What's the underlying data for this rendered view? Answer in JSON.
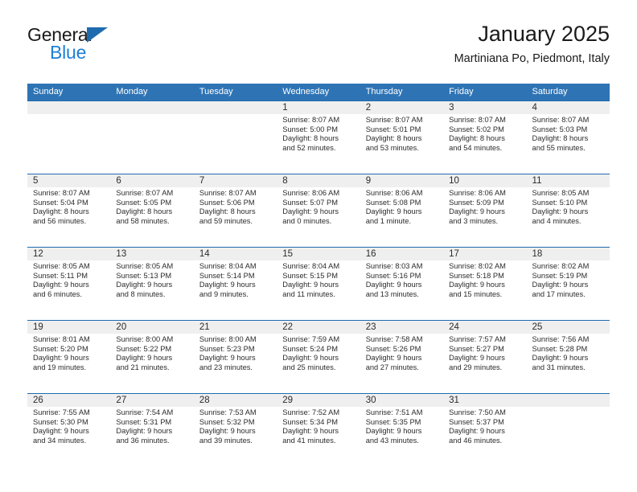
{
  "logo": {
    "word1": "General",
    "word2": "Blue",
    "triangle_color": "#1f6bb0",
    "blue_color": "#1f7fd4"
  },
  "header": {
    "title": "January 2025",
    "subtitle": "Martiniana Po, Piedmont, Italy"
  },
  "theme": {
    "header_blue": "#2e74b5",
    "rule_blue": "#1f6bb0",
    "band_gray": "#efefef"
  },
  "weekdays": [
    "Sunday",
    "Monday",
    "Tuesday",
    "Wednesday",
    "Thursday",
    "Friday",
    "Saturday"
  ],
  "weeks": [
    [
      {
        "day": "",
        "sunrise": "",
        "sunset": "",
        "daylight1": "",
        "daylight2": ""
      },
      {
        "day": "",
        "sunrise": "",
        "sunset": "",
        "daylight1": "",
        "daylight2": ""
      },
      {
        "day": "",
        "sunrise": "",
        "sunset": "",
        "daylight1": "",
        "daylight2": ""
      },
      {
        "day": "1",
        "sunrise": "Sunrise: 8:07 AM",
        "sunset": "Sunset: 5:00 PM",
        "daylight1": "Daylight: 8 hours",
        "daylight2": "and 52 minutes."
      },
      {
        "day": "2",
        "sunrise": "Sunrise: 8:07 AM",
        "sunset": "Sunset: 5:01 PM",
        "daylight1": "Daylight: 8 hours",
        "daylight2": "and 53 minutes."
      },
      {
        "day": "3",
        "sunrise": "Sunrise: 8:07 AM",
        "sunset": "Sunset: 5:02 PM",
        "daylight1": "Daylight: 8 hours",
        "daylight2": "and 54 minutes."
      },
      {
        "day": "4",
        "sunrise": "Sunrise: 8:07 AM",
        "sunset": "Sunset: 5:03 PM",
        "daylight1": "Daylight: 8 hours",
        "daylight2": "and 55 minutes."
      }
    ],
    [
      {
        "day": "5",
        "sunrise": "Sunrise: 8:07 AM",
        "sunset": "Sunset: 5:04 PM",
        "daylight1": "Daylight: 8 hours",
        "daylight2": "and 56 minutes."
      },
      {
        "day": "6",
        "sunrise": "Sunrise: 8:07 AM",
        "sunset": "Sunset: 5:05 PM",
        "daylight1": "Daylight: 8 hours",
        "daylight2": "and 58 minutes."
      },
      {
        "day": "7",
        "sunrise": "Sunrise: 8:07 AM",
        "sunset": "Sunset: 5:06 PM",
        "daylight1": "Daylight: 8 hours",
        "daylight2": "and 59 minutes."
      },
      {
        "day": "8",
        "sunrise": "Sunrise: 8:06 AM",
        "sunset": "Sunset: 5:07 PM",
        "daylight1": "Daylight: 9 hours",
        "daylight2": "and 0 minutes."
      },
      {
        "day": "9",
        "sunrise": "Sunrise: 8:06 AM",
        "sunset": "Sunset: 5:08 PM",
        "daylight1": "Daylight: 9 hours",
        "daylight2": "and 1 minute."
      },
      {
        "day": "10",
        "sunrise": "Sunrise: 8:06 AM",
        "sunset": "Sunset: 5:09 PM",
        "daylight1": "Daylight: 9 hours",
        "daylight2": "and 3 minutes."
      },
      {
        "day": "11",
        "sunrise": "Sunrise: 8:05 AM",
        "sunset": "Sunset: 5:10 PM",
        "daylight1": "Daylight: 9 hours",
        "daylight2": "and 4 minutes."
      }
    ],
    [
      {
        "day": "12",
        "sunrise": "Sunrise: 8:05 AM",
        "sunset": "Sunset: 5:11 PM",
        "daylight1": "Daylight: 9 hours",
        "daylight2": "and 6 minutes."
      },
      {
        "day": "13",
        "sunrise": "Sunrise: 8:05 AM",
        "sunset": "Sunset: 5:13 PM",
        "daylight1": "Daylight: 9 hours",
        "daylight2": "and 8 minutes."
      },
      {
        "day": "14",
        "sunrise": "Sunrise: 8:04 AM",
        "sunset": "Sunset: 5:14 PM",
        "daylight1": "Daylight: 9 hours",
        "daylight2": "and 9 minutes."
      },
      {
        "day": "15",
        "sunrise": "Sunrise: 8:04 AM",
        "sunset": "Sunset: 5:15 PM",
        "daylight1": "Daylight: 9 hours",
        "daylight2": "and 11 minutes."
      },
      {
        "day": "16",
        "sunrise": "Sunrise: 8:03 AM",
        "sunset": "Sunset: 5:16 PM",
        "daylight1": "Daylight: 9 hours",
        "daylight2": "and 13 minutes."
      },
      {
        "day": "17",
        "sunrise": "Sunrise: 8:02 AM",
        "sunset": "Sunset: 5:18 PM",
        "daylight1": "Daylight: 9 hours",
        "daylight2": "and 15 minutes."
      },
      {
        "day": "18",
        "sunrise": "Sunrise: 8:02 AM",
        "sunset": "Sunset: 5:19 PM",
        "daylight1": "Daylight: 9 hours",
        "daylight2": "and 17 minutes."
      }
    ],
    [
      {
        "day": "19",
        "sunrise": "Sunrise: 8:01 AM",
        "sunset": "Sunset: 5:20 PM",
        "daylight1": "Daylight: 9 hours",
        "daylight2": "and 19 minutes."
      },
      {
        "day": "20",
        "sunrise": "Sunrise: 8:00 AM",
        "sunset": "Sunset: 5:22 PM",
        "daylight1": "Daylight: 9 hours",
        "daylight2": "and 21 minutes."
      },
      {
        "day": "21",
        "sunrise": "Sunrise: 8:00 AM",
        "sunset": "Sunset: 5:23 PM",
        "daylight1": "Daylight: 9 hours",
        "daylight2": "and 23 minutes."
      },
      {
        "day": "22",
        "sunrise": "Sunrise: 7:59 AM",
        "sunset": "Sunset: 5:24 PM",
        "daylight1": "Daylight: 9 hours",
        "daylight2": "and 25 minutes."
      },
      {
        "day": "23",
        "sunrise": "Sunrise: 7:58 AM",
        "sunset": "Sunset: 5:26 PM",
        "daylight1": "Daylight: 9 hours",
        "daylight2": "and 27 minutes."
      },
      {
        "day": "24",
        "sunrise": "Sunrise: 7:57 AM",
        "sunset": "Sunset: 5:27 PM",
        "daylight1": "Daylight: 9 hours",
        "daylight2": "and 29 minutes."
      },
      {
        "day": "25",
        "sunrise": "Sunrise: 7:56 AM",
        "sunset": "Sunset: 5:28 PM",
        "daylight1": "Daylight: 9 hours",
        "daylight2": "and 31 minutes."
      }
    ],
    [
      {
        "day": "26",
        "sunrise": "Sunrise: 7:55 AM",
        "sunset": "Sunset: 5:30 PM",
        "daylight1": "Daylight: 9 hours",
        "daylight2": "and 34 minutes."
      },
      {
        "day": "27",
        "sunrise": "Sunrise: 7:54 AM",
        "sunset": "Sunset: 5:31 PM",
        "daylight1": "Daylight: 9 hours",
        "daylight2": "and 36 minutes."
      },
      {
        "day": "28",
        "sunrise": "Sunrise: 7:53 AM",
        "sunset": "Sunset: 5:32 PM",
        "daylight1": "Daylight: 9 hours",
        "daylight2": "and 39 minutes."
      },
      {
        "day": "29",
        "sunrise": "Sunrise: 7:52 AM",
        "sunset": "Sunset: 5:34 PM",
        "daylight1": "Daylight: 9 hours",
        "daylight2": "and 41 minutes."
      },
      {
        "day": "30",
        "sunrise": "Sunrise: 7:51 AM",
        "sunset": "Sunset: 5:35 PM",
        "daylight1": "Daylight: 9 hours",
        "daylight2": "and 43 minutes."
      },
      {
        "day": "31",
        "sunrise": "Sunrise: 7:50 AM",
        "sunset": "Sunset: 5:37 PM",
        "daylight1": "Daylight: 9 hours",
        "daylight2": "and 46 minutes."
      },
      {
        "day": "",
        "sunrise": "",
        "sunset": "",
        "daylight1": "",
        "daylight2": ""
      }
    ]
  ]
}
